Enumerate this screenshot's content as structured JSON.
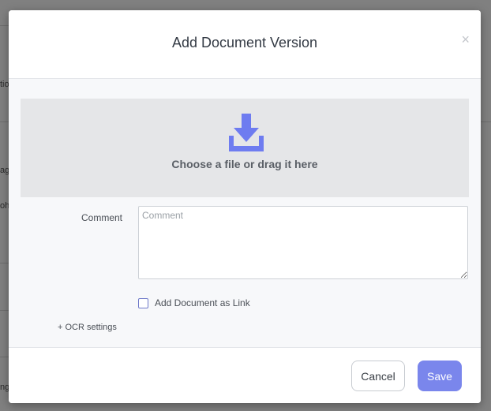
{
  "background": {
    "fragments": [
      "tio",
      "ag",
      "oh",
      "ng"
    ]
  },
  "modal": {
    "title": "Add Document Version",
    "close_glyph": "×",
    "dropzone": {
      "icon": "download-icon",
      "text": "Choose a file or drag it here"
    },
    "comment": {
      "label": "Comment",
      "placeholder": "Comment",
      "value": ""
    },
    "link_checkbox": {
      "label": "Add Document as Link",
      "checked": false
    },
    "ocr_settings": "+ OCR settings",
    "footer": {
      "cancel_label": "Cancel",
      "save_label": "Save"
    }
  },
  "colors": {
    "accent": "#7a86ec",
    "dropzone_bg": "#e5e6e8",
    "overlay": "#808080"
  }
}
